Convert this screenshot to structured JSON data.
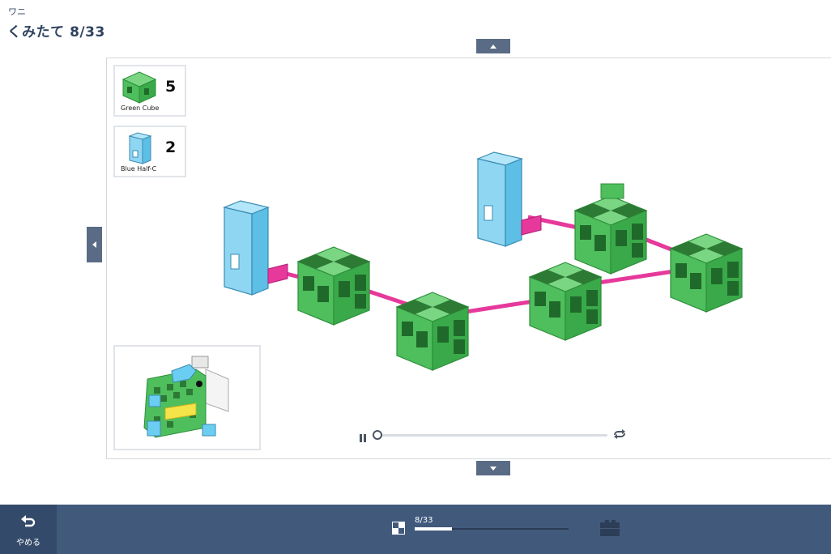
{
  "header": {
    "subtitle": "ワニ",
    "title": "くみたて 8/33"
  },
  "parts": [
    {
      "name": "Green Cube",
      "count": "5",
      "color": "#3cb24a"
    },
    {
      "name": "Blue Half-C",
      "count": "2",
      "color": "#62c3ea"
    }
  ],
  "player": {
    "progress": 0.0,
    "state": "paused"
  },
  "footer": {
    "quit_label": "やめる",
    "step_text": "8/33",
    "step_progress": 0.2424
  },
  "colors": {
    "bar": "#415a7c",
    "quit": "#344a6a",
    "green": "#4cc35a",
    "blue": "#6ccdf2",
    "connector": "#e6399b"
  },
  "icons": [
    "chevron-up-icon",
    "chevron-down-icon",
    "chevron-left-icon",
    "pause-icon",
    "loop-icon",
    "undo-icon",
    "step-progress-icon",
    "build-mode-icon"
  ]
}
